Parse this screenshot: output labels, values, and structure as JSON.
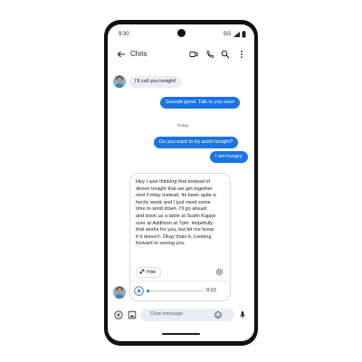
{
  "status_bar": {
    "time": "9:30",
    "network": "5G"
  },
  "header": {
    "contact_name": "Chris"
  },
  "icons": {
    "back": "back-arrow-icon",
    "video": "video-call-icon",
    "phone": "phone-icon",
    "search": "search-icon",
    "more": "more-vert-icon",
    "settings": "gear-icon",
    "play": "play-icon",
    "collapse": "collapse-icon",
    "add": "add-icon",
    "gallery": "gallery-icon",
    "emoji": "emoji-icon",
    "mic": "mic-icon"
  },
  "messages": {
    "m1": "I'll call you tonight!",
    "m2": "Sounds good. Talk to you soon",
    "divider": "Today",
    "m3": "Do you want to try sushi tonight?",
    "m4": "I am hungry"
  },
  "card": {
    "text": "Hey I was thinking that instead of\ndinner tonight that we get together\nnext Friday instead. Its been quite a\nhectic week and I just need some\ntime to wind down.  I'll go ahead\nand book us a table at Sushi Kappo\nover at Addilson at 7pm.  Hopefully\nthat works for you, but let me know\nif it doesn't. Okay thats it. Looking\nforward to seeing you.",
    "hide_label": "Hide",
    "audio_duration": "0:22",
    "audio_progress": 0.0
  },
  "compose": {
    "placeholder": "Chat message"
  },
  "colors": {
    "accent": "#1a73e8",
    "incoming": "#e9eef6",
    "frame": "#111111"
  }
}
